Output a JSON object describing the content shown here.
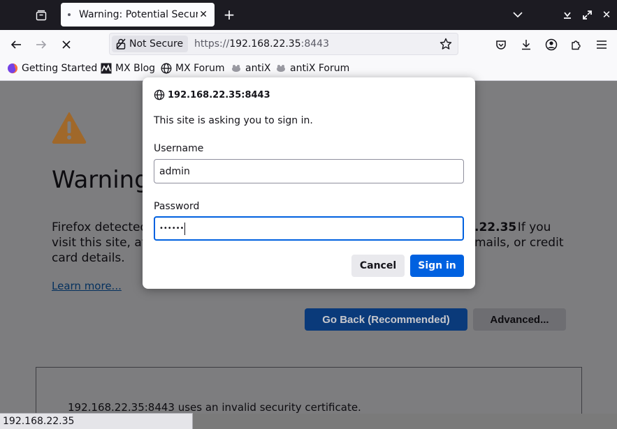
{
  "tabs": {
    "active_title": "Warning: Potential Security Risk Ahead"
  },
  "navbar": {
    "security_label": "Not Secure",
    "url_scheme": "https://",
    "url_host": "192.168.22.35",
    "url_port": ":8443"
  },
  "bookmarks": [
    {
      "label": "Getting Started",
      "icon": "firefox-icon"
    },
    {
      "label": "MX Blog",
      "icon": "mx-icon"
    },
    {
      "label": "MX Forum",
      "icon": "globe-icon"
    },
    {
      "label": "antiX",
      "icon": "antix-icon"
    },
    {
      "label": "antiX Forum",
      "icon": "antix-icon"
    }
  ],
  "page": {
    "title": "Warning",
    "body_line1_start": "Firefox detected",
    "body_line1_end": ".22.35",
    "body_line1_tail": ". If you",
    "body_line2_start": "visit this site, att",
    "body_line2_end": "mails, or credit",
    "body_line3": "card details.",
    "learn_more": "Learn more...",
    "go_back": "Go Back (Recommended)",
    "advanced": "Advanced...",
    "cert_text": "192.168.22.35:8443 uses an invalid security certificate."
  },
  "status_bar": "192.168.22.35",
  "dialog": {
    "origin": "192.168.22.35:8443",
    "message": "This site is asking you to sign in.",
    "username_label": "Username",
    "username_value": "admin",
    "password_label": "Password",
    "password_value": "••••••",
    "cancel": "Cancel",
    "sign_in": "Sign in"
  },
  "colors": {
    "accent": "#0061e0",
    "warning": "#e8a13a"
  }
}
